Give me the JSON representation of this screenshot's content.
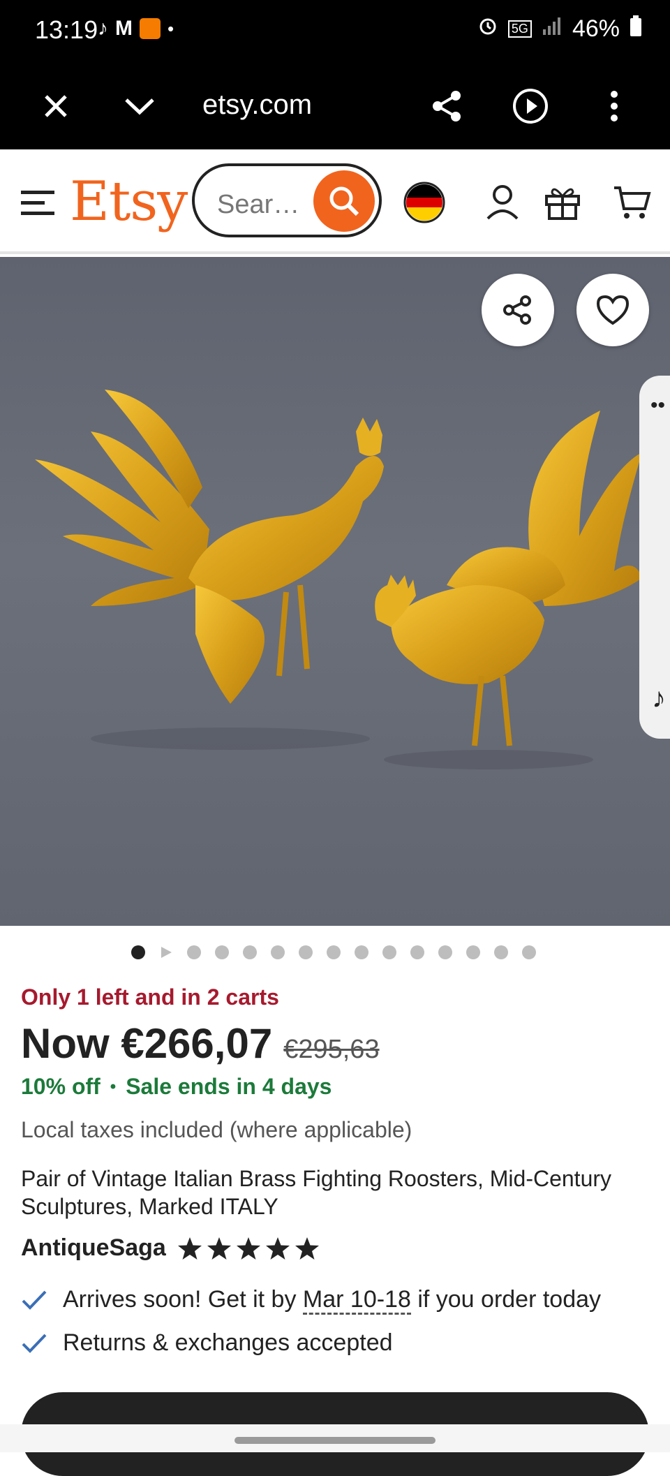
{
  "status_bar": {
    "time": "13:19",
    "battery": "46%",
    "network": "5G"
  },
  "browser": {
    "url": "etsy.com"
  },
  "header": {
    "logo": "Etsy",
    "search_placeholder": "Sear…"
  },
  "product": {
    "stock_notice": "Only 1 left and in 2 carts",
    "price_now": "Now €266,07",
    "price_original": "€295,63",
    "discount": "10% off",
    "separator": "•",
    "sale_ends": "Sale ends in 4 days",
    "tax_note": "Local taxes included (where applicable)",
    "title": "Pair of Vintage Italian Brass Fighting Roosters, Mid-Century Sculptures, Marked ITALY",
    "shop_name": "AntiqueSaga",
    "rating_stars": 5,
    "image_count": 15,
    "active_image": 1
  },
  "features": {
    "arrival_prefix": "Arrives soon! Get it by ",
    "arrival_date": "Mar 10-18",
    "arrival_suffix": " if you order today",
    "returns": "Returns & exchanges accepted"
  },
  "colors": {
    "brand": "#f1641e",
    "stock": "#a61a2e",
    "sale": "#1c7a3a"
  }
}
